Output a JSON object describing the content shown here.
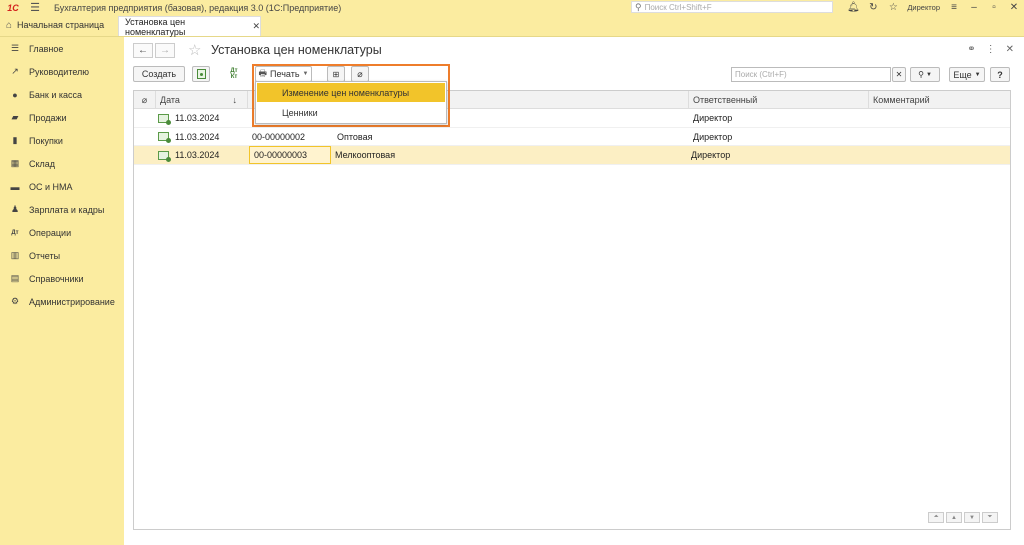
{
  "titlebar": {
    "logo": "1С",
    "app_title": "Бухгалтерия предприятия (базовая), редакция 3.0  (1С:Предприятие)",
    "search_placeholder": "Поиск Ctrl+Shift+F",
    "user": "Директор"
  },
  "tabs": {
    "home": "Начальная страница",
    "active": "Установка цен номенклатуры"
  },
  "sidebar": {
    "items": [
      {
        "label": "Главное",
        "icon": "menu-lines-icon"
      },
      {
        "label": "Руководителю",
        "icon": "trend-chart-icon"
      },
      {
        "label": "Банк и касса",
        "icon": "coin-icon"
      },
      {
        "label": "Продажи",
        "icon": "shopping-bag-icon"
      },
      {
        "label": "Покупки",
        "icon": "cart-icon"
      },
      {
        "label": "Склад",
        "icon": "warehouse-icon"
      },
      {
        "label": "ОС и НМА",
        "icon": "truck-icon"
      },
      {
        "label": "Зарплата и кадры",
        "icon": "person-icon"
      },
      {
        "label": "Операции",
        "icon": "dt-kt-icon"
      },
      {
        "label": "Отчеты",
        "icon": "bar-chart-icon"
      },
      {
        "label": "Справочники",
        "icon": "books-icon"
      },
      {
        "label": "Администрирование",
        "icon": "gear-icon"
      }
    ]
  },
  "page": {
    "title": "Установка цен номенклатуры"
  },
  "toolbar": {
    "create": "Создать",
    "print": "Печать",
    "search_placeholder": "Поиск (Ctrl+F)",
    "more": "Еще",
    "help": "?"
  },
  "print_menu": {
    "items": [
      "Изменение цен номенклатуры",
      "Ценники"
    ]
  },
  "table": {
    "headers": {
      "date": "Дата",
      "responsible": "Ответственный",
      "comment": "Комментарий"
    },
    "rows": [
      {
        "date": "11.03.2024",
        "number": "",
        "type": "",
        "responsible": "Директор",
        "comment": ""
      },
      {
        "date": "11.03.2024",
        "number": "00-00000002",
        "type": "Оптовая",
        "responsible": "Директор",
        "comment": ""
      },
      {
        "date": "11.03.2024",
        "number": "00-00000003",
        "type": "Мелкооптовая",
        "responsible": "Директор",
        "comment": ""
      }
    ]
  },
  "colors": {
    "panel_bg": "#fbeca0",
    "highlight_border": "#ee7d2b",
    "menu_active": "#f2c42a",
    "selected_row": "#fcefc4"
  }
}
